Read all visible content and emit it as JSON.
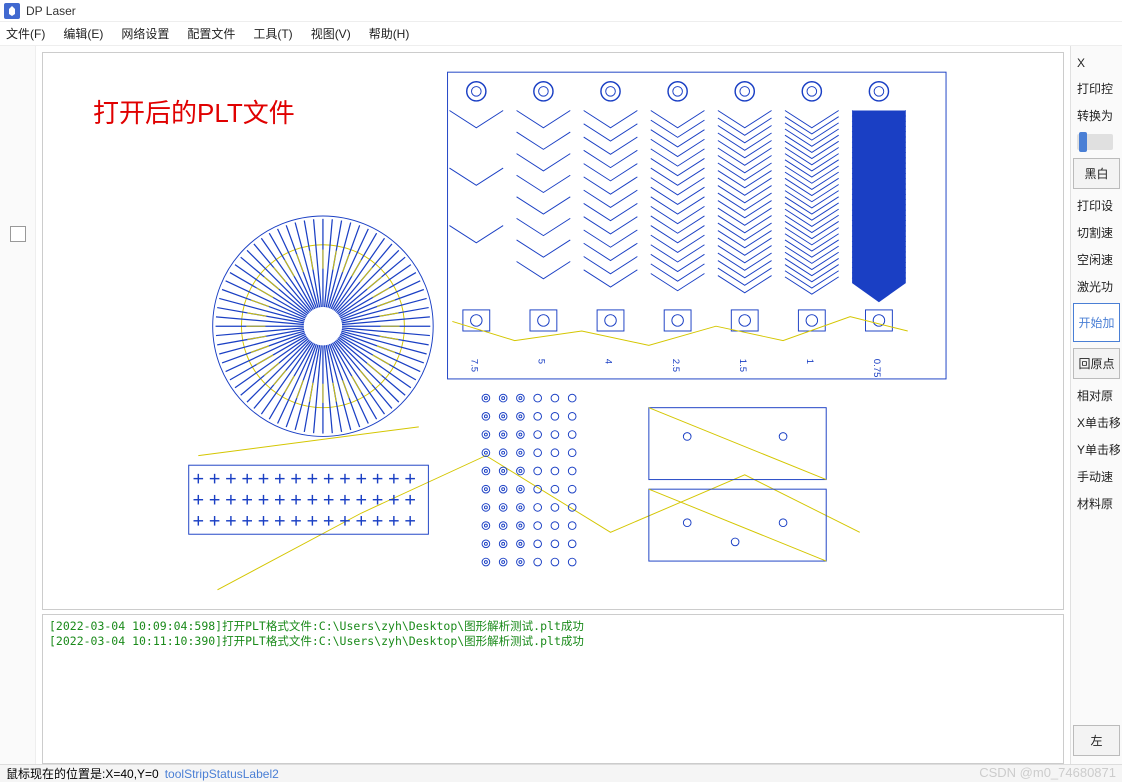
{
  "app": {
    "title": "DP Laser"
  },
  "menu": {
    "file": "文件(F)",
    "edit": "编辑(E)",
    "network": "网络设置",
    "config": "配置文件",
    "tools": "工具(T)",
    "view": "视图(V)",
    "help": "帮助(H)"
  },
  "overlay": {
    "label": "打开后的PLT文件"
  },
  "log": {
    "lines": [
      "[2022-03-04 10:09:04:598]打开PLT格式文件:C:\\Users\\zyh\\Desktop\\图形解析测试.plt成功",
      "[2022-03-04 10:11:10:390]打开PLT格式文件:C:\\Users\\zyh\\Desktop\\图形解析测试.plt成功"
    ]
  },
  "right": {
    "x_label": "X",
    "print_ctrl": "打印控",
    "convert_to": "转换为",
    "bw_btn": "黑白",
    "print_set": "打印设",
    "cut_speed": "切割速",
    "idle_speed": "空闲速",
    "laser_power": "激光功",
    "start_proc": "开始加",
    "return_origin": "回原点",
    "rel_origin": "相对原",
    "x_click_move": "X单击移",
    "y_click_move": "Y单击移",
    "manual_speed": "手动速",
    "material_origin": "材料原",
    "left_btn": "左"
  },
  "status": {
    "mouse_pos": "鼠标现在的位置是:X=40,Y=0",
    "label2": "toolStripStatusLabel2"
  },
  "watermark": "CSDN @m0_74680871",
  "canvas": {
    "shape_labels": [
      "7.5",
      "5",
      "4",
      "2.5",
      "1.5",
      "1",
      "0.75"
    ]
  }
}
